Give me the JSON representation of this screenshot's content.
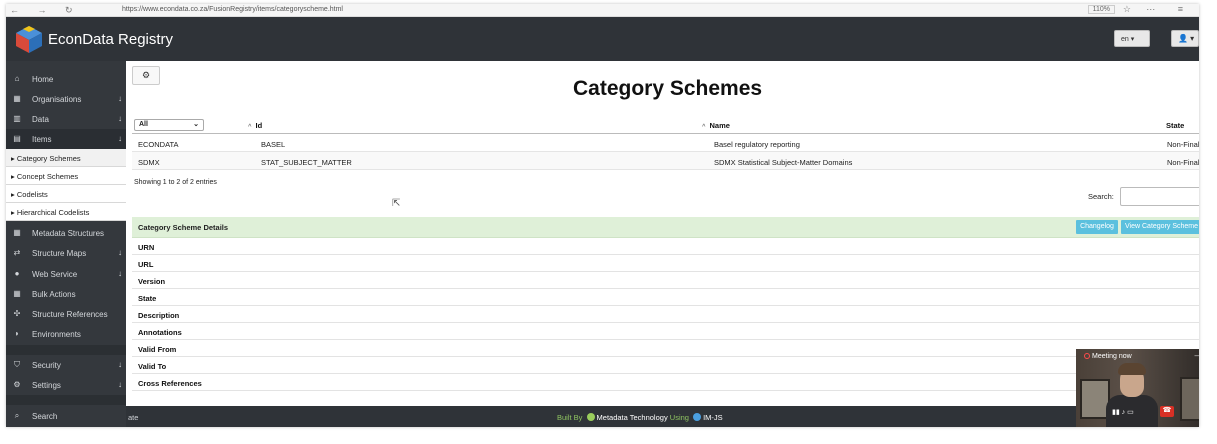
{
  "browser": {
    "nav_glyphs": "← → ↻",
    "url": "https://www.econdata.co.za/FusionRegistry/items/categoryscheme.html",
    "zoom": "110%",
    "menu_glyphs": "⋯ ≡"
  },
  "header": {
    "brand": "EconData Registry",
    "lang": "en ▾",
    "user_glyph": "👤 ▾"
  },
  "sidebar": {
    "items": [
      {
        "label": "Home",
        "icon": "home-icon",
        "glyph": "⌂"
      },
      {
        "label": "Organisations",
        "icon": "building-icon",
        "glyph": "▦",
        "arrow": "↓"
      },
      {
        "label": "Data",
        "icon": "bar-chart-icon",
        "glyph": "▥",
        "arrow": "↓"
      },
      {
        "label": "Items",
        "icon": "list-icon",
        "glyph": "▤",
        "arrow": "↓"
      },
      {
        "label": "Metadata Structures",
        "icon": "grid-icon",
        "glyph": "▦"
      },
      {
        "label": "Structure Maps",
        "icon": "exchange-icon",
        "glyph": "⇄",
        "arrow": "↓"
      },
      {
        "label": "Web Service",
        "icon": "globe-icon",
        "glyph": "●",
        "arrow": "↓"
      },
      {
        "label": "Bulk Actions",
        "icon": "grid-icon",
        "glyph": "▦"
      },
      {
        "label": "Structure References",
        "icon": "sitemap-icon",
        "glyph": "✣"
      },
      {
        "label": "Environments",
        "icon": "leaf-icon",
        "glyph": "◗"
      },
      {
        "label": "Security",
        "icon": "shield-icon",
        "glyph": "⛉",
        "arrow": "↓"
      },
      {
        "label": "Settings",
        "icon": "gears-icon",
        "glyph": "⚙",
        "arrow": "↓"
      },
      {
        "label": "Search",
        "icon": "search-icon",
        "glyph": "⌕"
      }
    ],
    "sub_items": [
      {
        "label": "Category Schemes"
      },
      {
        "label": "Concept Schemes"
      },
      {
        "label": "Codelists"
      },
      {
        "label": "Hierarchical Codelists"
      }
    ],
    "sub_glyph": "▸"
  },
  "main": {
    "title": "Category Schemes",
    "gear_glyph": "⚙",
    "filter": {
      "selected": "All",
      "caret": "⌄"
    },
    "table": {
      "sort_glyph": "^",
      "columns": [
        "Id",
        "Name",
        "State"
      ],
      "rows": [
        {
          "agency": "ECONDATA",
          "id": "BASEL",
          "name": "Basel regulatory reporting",
          "state": "Non-Final"
        },
        {
          "agency": "SDMX",
          "id": "STAT_SUBJECT_MATTER",
          "name": "SDMX Statistical Subject-Matter Domains",
          "state": "Non-Final"
        }
      ]
    },
    "info": "Showing 1 to 2 of 2 entries",
    "search_label": "Search:",
    "details": {
      "title": "Category Scheme Details",
      "changelog_btn": "Changelog",
      "view_btn": "View Category Scheme",
      "fields": [
        "URN",
        "URL",
        "Version",
        "State",
        "Description",
        "Annotations",
        "Valid From",
        "Valid To",
        "Cross References"
      ]
    }
  },
  "footer": {
    "left": "ate",
    "built_by": "Built By",
    "company": "Metadata Technology",
    "using": "Using",
    "lib": "IM-JS"
  },
  "video": {
    "status": "Meeting now",
    "controls": "▮▮  ♪  ▭",
    "hangup_glyph": "☎",
    "minimize": "–"
  },
  "colors": {
    "header_bg": "#2f3338",
    "sidebar_bg": "#34383d",
    "details_bg": "#dff0d8",
    "button_info": "#5bc0de",
    "footer_green": "#8fc461"
  }
}
